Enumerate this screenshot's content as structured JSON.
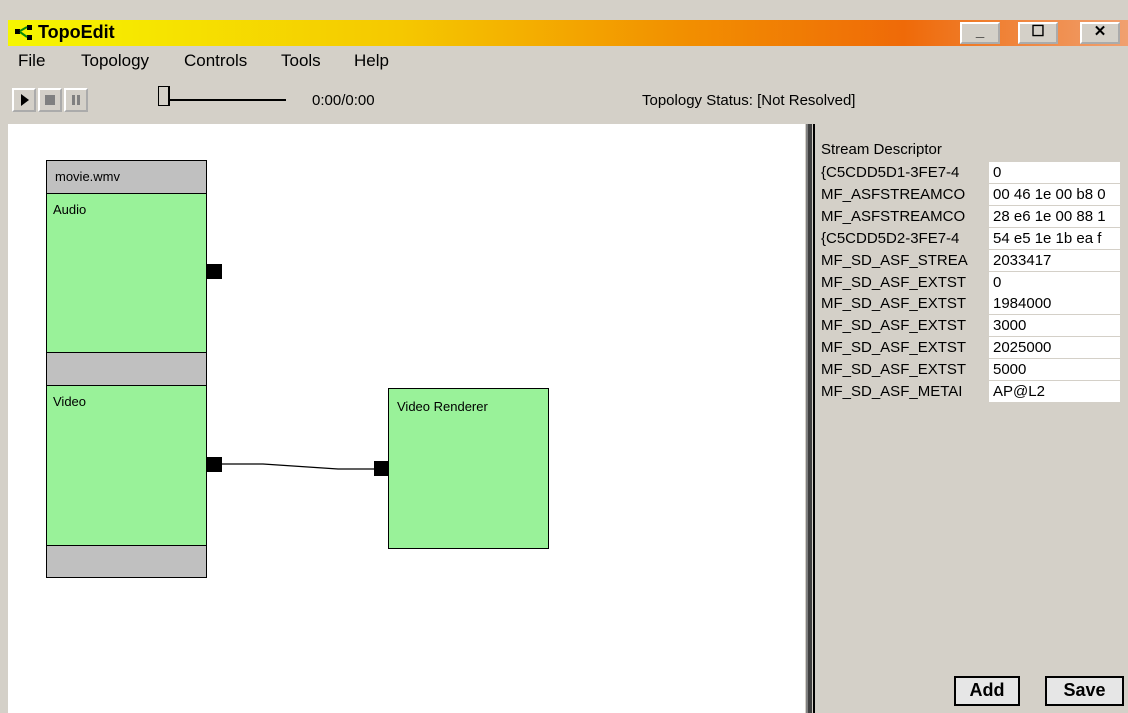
{
  "window": {
    "title": "TopoEdit",
    "minimize_glyph": "_",
    "maximize_glyph": "☐",
    "close_glyph": "✕"
  },
  "menu": [
    "File",
    "Topology",
    "Controls",
    "Tools",
    "Help"
  ],
  "toolbar": {
    "play_icon": "play-icon",
    "stop_icon": "stop-icon",
    "pause_icon": "pause-icon",
    "time": "0:00/0:00",
    "status": "Topology Status: [Not Resolved]"
  },
  "topology": {
    "source": {
      "name": "movie.wmv",
      "streams": [
        "Audio",
        "Video"
      ]
    },
    "renderer": {
      "name": "Video Renderer"
    }
  },
  "properties": {
    "title": "Stream Descriptor",
    "rows": [
      {
        "key": "{C5CDD5D1-3FE7-4",
        "value": "0"
      },
      {
        "key": "MF_ASFSTREAMCO",
        "value": "00 46 1e 00 b8 0"
      },
      {
        "key": "MF_ASFSTREAMCO",
        "value": "28 e6 1e 00 88 1"
      },
      {
        "key": "{C5CDD5D2-3FE7-4",
        "value": "54 e5 1e 1b ea f"
      },
      {
        "key": "MF_SD_ASF_STREA",
        "value": "2033417"
      },
      {
        "key": "MF_SD_ASF_EXTST",
        "value": "0"
      },
      {
        "key": "MF_SD_ASF_EXTST",
        "value": "1984000"
      },
      {
        "key": "MF_SD_ASF_EXTST",
        "value": "3000"
      },
      {
        "key": "MF_SD_ASF_EXTST",
        "value": "2025000"
      },
      {
        "key": "MF_SD_ASF_EXTST",
        "value": "5000"
      },
      {
        "key": "MF_SD_ASF_METAI",
        "value": "AP@L2"
      }
    ],
    "add_label": "Add",
    "save_label": "Save"
  }
}
